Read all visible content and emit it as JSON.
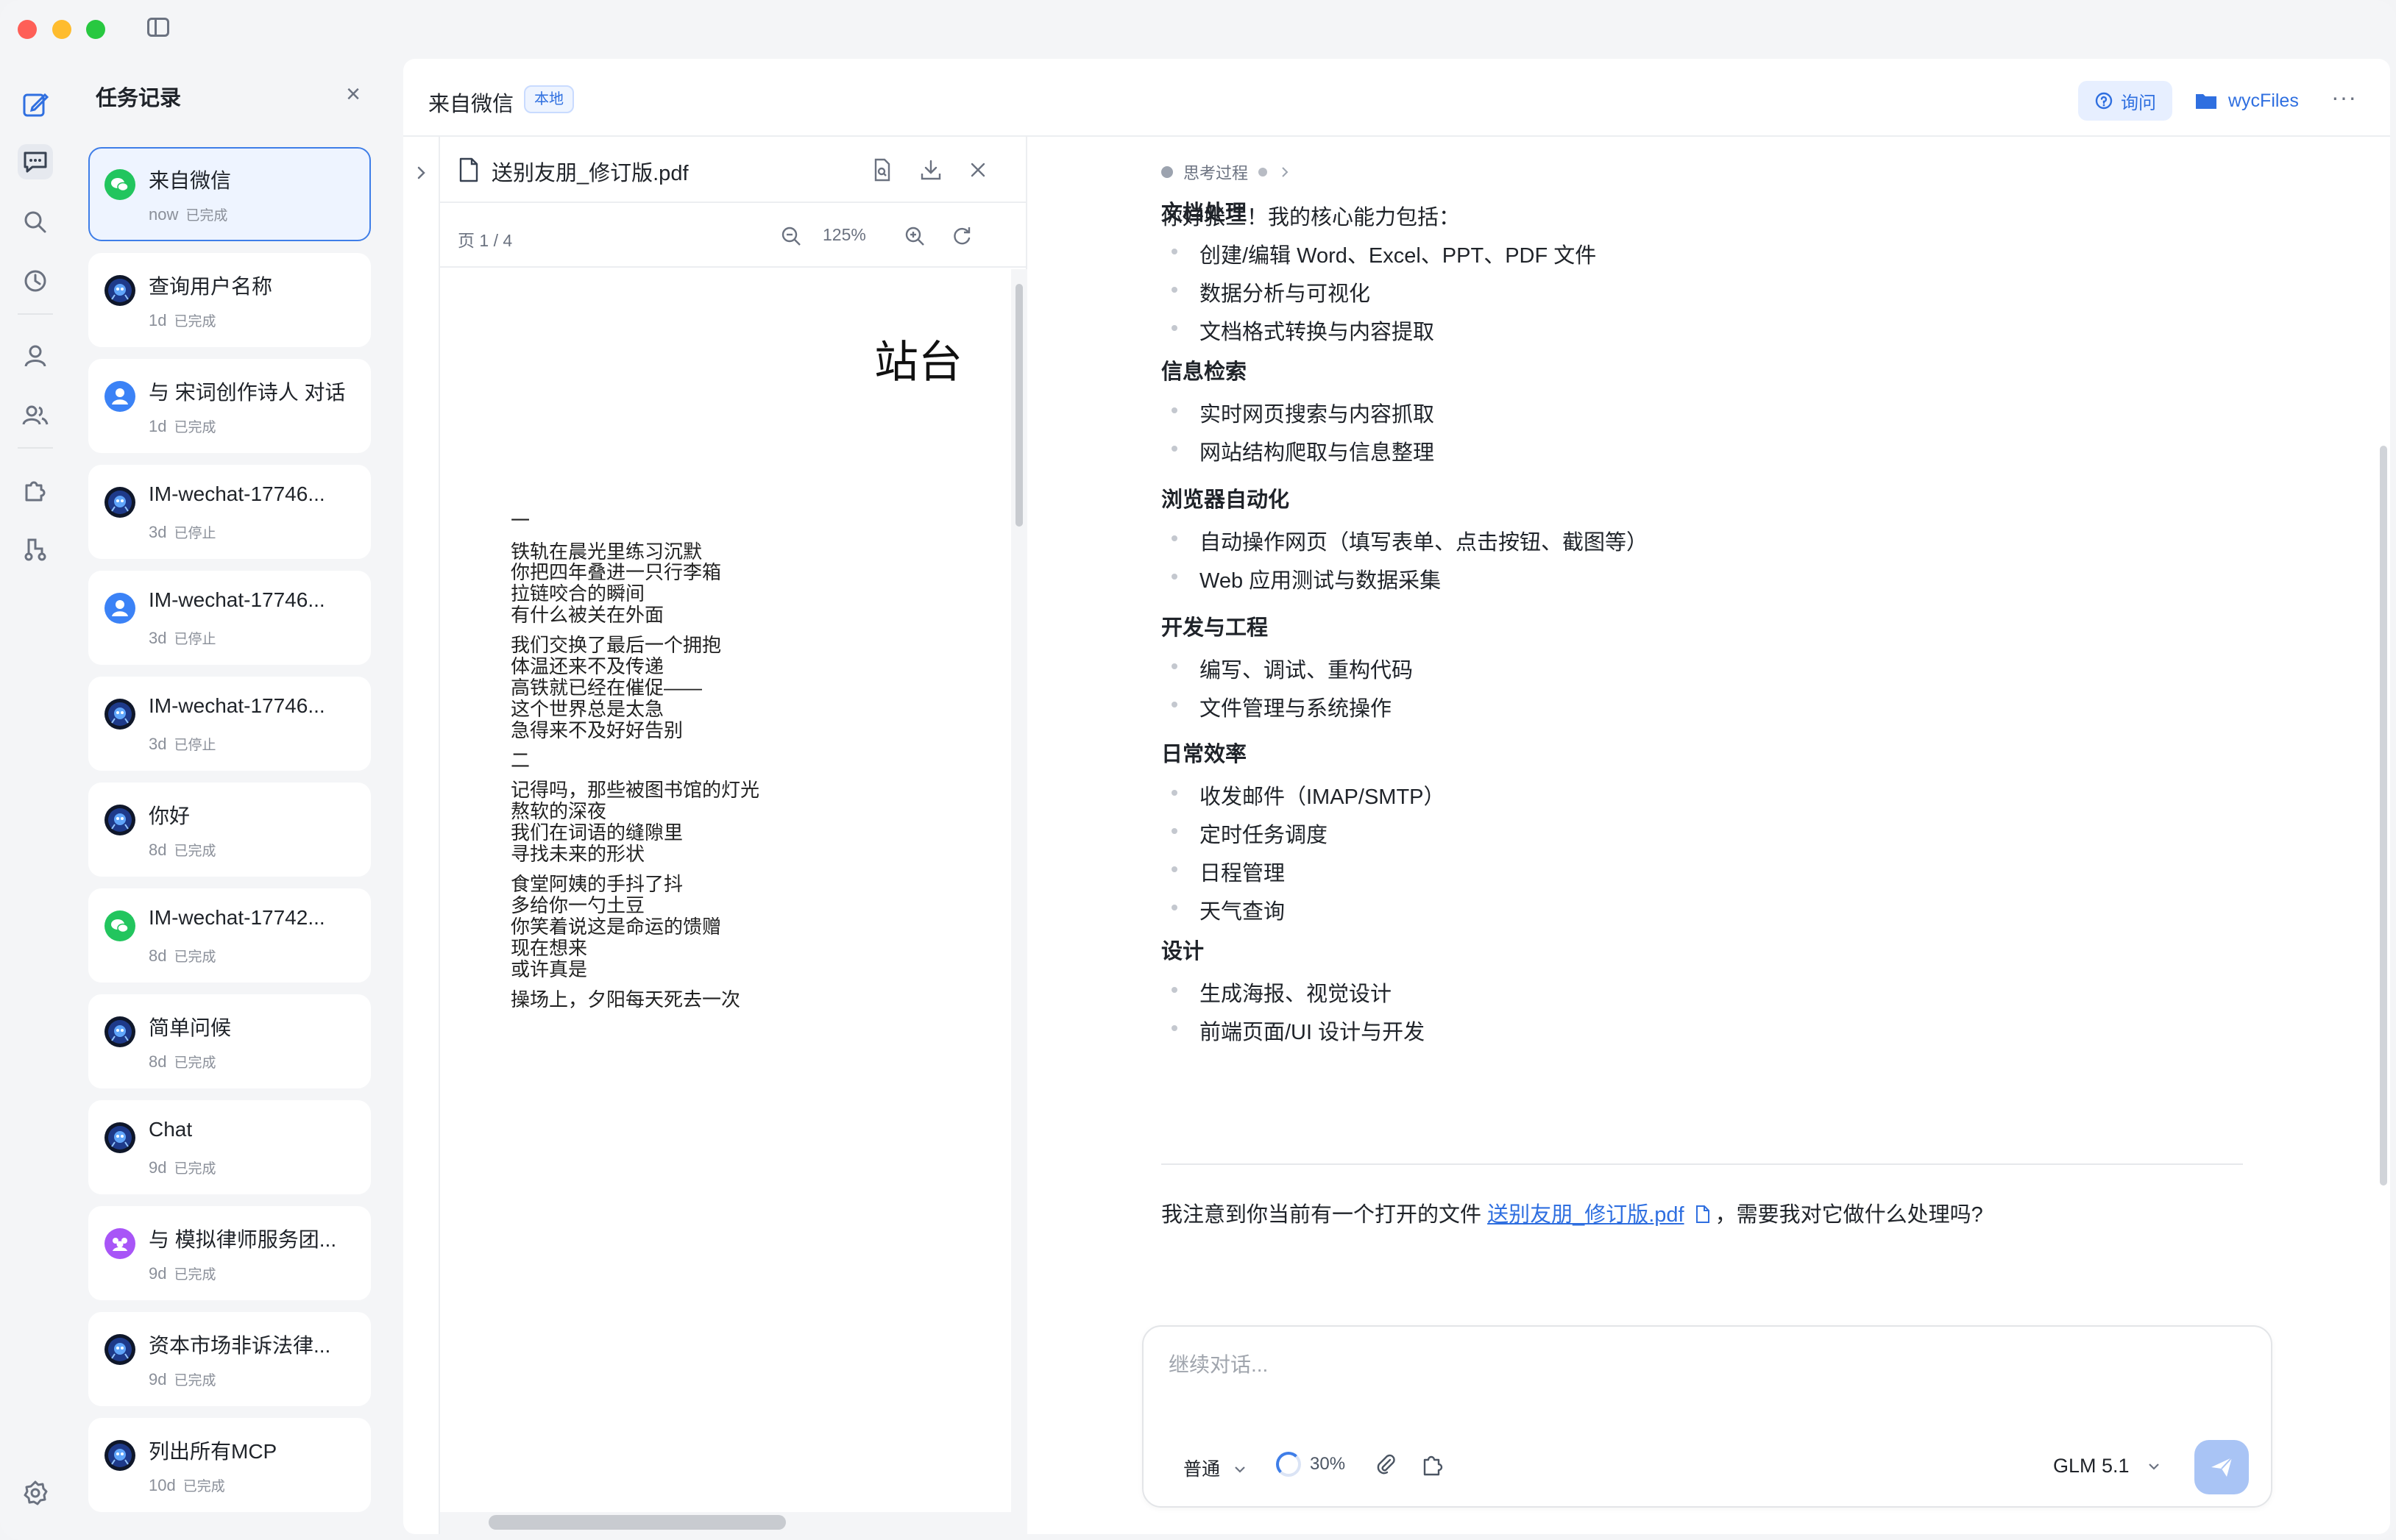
{
  "sidebar": {
    "title": "任务记录",
    "items": [
      {
        "name": "来自微信",
        "time": "now",
        "status": "已完成",
        "avatar": "wechat",
        "color": "#22c55e"
      },
      {
        "name": "查询用户名称",
        "time": "1d",
        "status": "已完成",
        "avatar": "bot",
        "color": "#1e3a8a"
      },
      {
        "name": "与 宋词创作诗人 对话",
        "time": "1d",
        "status": "已完成",
        "avatar": "person",
        "color": "#3b82f6"
      },
      {
        "name": "IM-wechat-17746...",
        "time": "3d",
        "status": "已停止",
        "avatar": "bot",
        "color": "#1e3a8a"
      },
      {
        "name": "IM-wechat-17746...",
        "time": "3d",
        "status": "已停止",
        "avatar": "person",
        "color": "#3b82f6"
      },
      {
        "name": "IM-wechat-17746...",
        "time": "3d",
        "status": "已停止",
        "avatar": "bot",
        "color": "#1e3a8a"
      },
      {
        "name": "你好",
        "time": "8d",
        "status": "已完成",
        "avatar": "bot",
        "color": "#1e3a8a"
      },
      {
        "name": "IM-wechat-17742...",
        "time": "8d",
        "status": "已完成",
        "avatar": "wechat",
        "color": "#22c55e"
      },
      {
        "name": "简单问候",
        "time": "8d",
        "status": "已完成",
        "avatar": "bot",
        "color": "#1e3a8a"
      },
      {
        "name": "Chat",
        "time": "9d",
        "status": "已完成",
        "avatar": "bot",
        "color": "#1e3a8a"
      },
      {
        "name": "与 模拟律师服务团...",
        "time": "9d",
        "status": "已完成",
        "avatar": "group",
        "color": "#a855f7"
      },
      {
        "name": "资本市场非诉法律...",
        "time": "9d",
        "status": "已完成",
        "avatar": "bot",
        "color": "#1e3a8a"
      },
      {
        "name": "列出所有MCP",
        "time": "10d",
        "status": "已完成",
        "avatar": "bot",
        "color": "#1e3a8a"
      }
    ]
  },
  "header": {
    "title": "来自微信",
    "badge": "本地",
    "ask_label": "询问",
    "files_label": "wycFiles"
  },
  "pdf": {
    "filename": "送别友朋_修订版.pdf",
    "page_indicator": "页 1 / 4",
    "zoom": "125%",
    "title": "站台",
    "lines": [
      "一",
      "铁轨在晨光里练习沉默",
      "你把四年叠进一只行李箱",
      "拉链咬合的瞬间",
      "有什么被关在外面",
      "我们交换了最后一个拥抱",
      "体温还来不及传递",
      "高铁就已经在催促——",
      "这个世界总是太急",
      "急得来不及好好告别",
      "二",
      "记得吗，那些被图书馆的灯光",
      "熬软的深夜",
      "我们在词语的缝隙里",
      "寻找未来的形状",
      "食堂阿姨的手抖了抖",
      "多给你一勺土豆",
      "你笑着说这是命运的馈赠",
      "现在想来",
      "或许真是",
      "操场上，夕阳每天死去一次"
    ]
  },
  "chat": {
    "thinking_label": "思考过程",
    "intro": "你好张三！我的核心能力包括：",
    "sections": [
      {
        "heading": "文档处理",
        "items": [
          "创建/编辑 Word、Excel、PPT、PDF 文件",
          "数据分析与可视化",
          "文档格式转换与内容提取"
        ]
      },
      {
        "heading": "信息检索",
        "items": [
          "实时网页搜索与内容抓取",
          "网站结构爬取与信息整理"
        ]
      },
      {
        "heading": "浏览器自动化",
        "items": [
          "自动操作网页（填写表单、点击按钮、截图等）",
          "Web 应用测试与数据采集"
        ]
      },
      {
        "heading": "开发与工程",
        "items": [
          "编写、调试、重构代码",
          "文件管理与系统操作"
        ]
      },
      {
        "heading": "日常效率",
        "items": [
          "收发邮件（IMAP/SMTP）",
          "定时任务调度",
          "日程管理",
          "天气查询"
        ]
      },
      {
        "heading": "设计",
        "items": [
          "生成海报、视觉设计",
          "前端页面/UI 设计与开发"
        ]
      }
    ],
    "closing_prefix": "我注意到你当前有一个打开的文件 ",
    "closing_link": "送别友朋_修订版.pdf",
    "closing_suffix": "，需要我对它做什么处理吗?"
  },
  "composer": {
    "placeholder": "继续对话...",
    "mode": "普通",
    "progress": "30%",
    "model": "GLM 5.1"
  },
  "colors": {
    "accent": "#2f6fe0",
    "close": "#fe5f57",
    "minimize": "#febc2e",
    "zoom": "#28c840"
  }
}
